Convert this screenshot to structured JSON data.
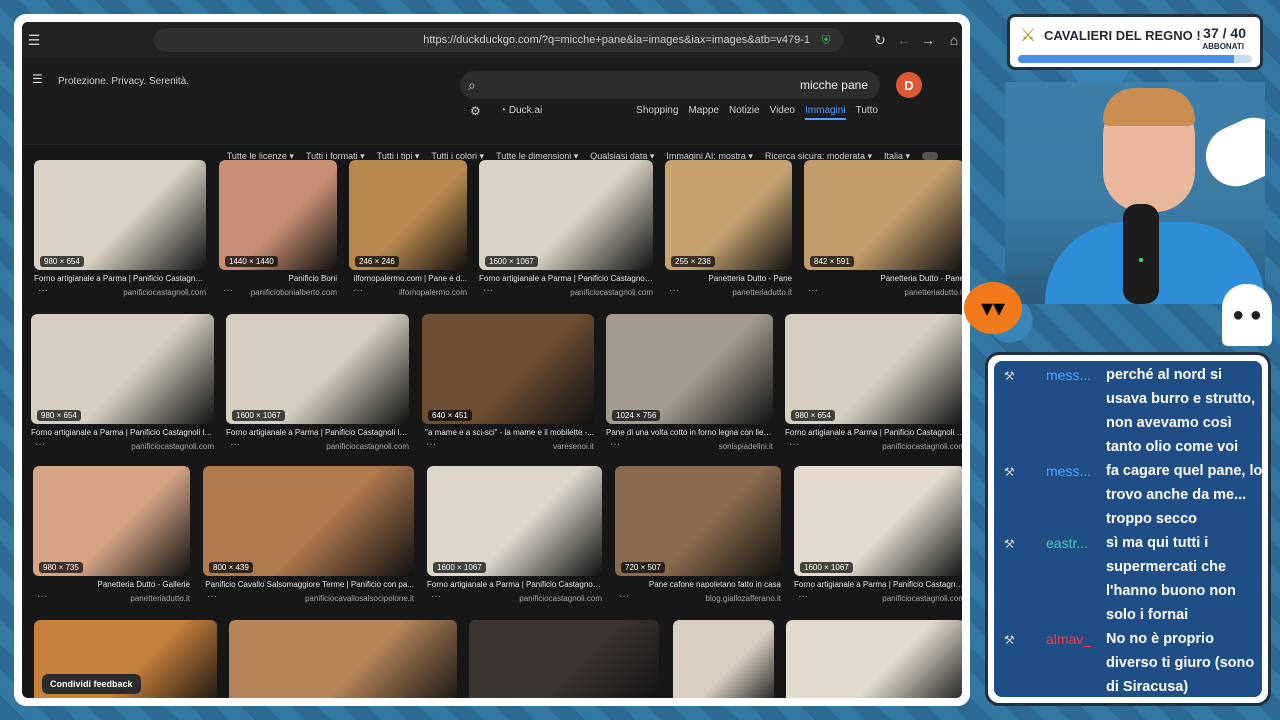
{
  "browser": {
    "url": "https://duckduckgo.com/?q=micche+pane&ia=images&iax=images&atb=v479-1",
    "tagline": "Protezione. Privacy. Serenità.",
    "search_query": "micche pane",
    "tabs": [
      "Tutto",
      "Immagini",
      "Video",
      "Notizie",
      "Mappe",
      "Shopping"
    ],
    "active_tab": "Immagini",
    "duck_ai": "Duck.ai",
    "filters": [
      "Italia",
      "Ricerca sicura: moderata",
      "Immagini AI: mostra",
      "Qualsiasi data",
      "Tutte le dimensioni",
      "Tutti i colori",
      "Tutti i tipi",
      "Tutti i formati",
      "Tutte le licenze"
    ],
    "feedback_label": "Condividi feedback"
  },
  "images": [
    {
      "title": "Forno artigianale a Parma | Panificio Castagnol...",
      "source": "panificiocastagnoli.com",
      "dim": "980 × 654",
      "color": "#d9d2c4"
    },
    {
      "title": "Panificio Boni",
      "source": "panificiobonialberto.com",
      "dim": "1440 × 1440",
      "color": "#c88f74"
    },
    {
      "title": "ilfornopalermo.com | Pane e d...",
      "source": "ilfornopalermo.com",
      "dim": "246 × 246",
      "color": "#b8894e"
    },
    {
      "title": "Forno artigianale a Parma | Panificio Castagnol...",
      "source": "panificiocastagnoli.com",
      "dim": "1600 × 1067",
      "color": "#d9d2c4"
    },
    {
      "title": "Panetteria Dutto - Pane",
      "source": "panetteriadutto.it",
      "dim": "255 × 236",
      "color": "#c6a271"
    },
    {
      "title": "Panetteria Dutto - Pane",
      "source": "panetteriadutto.it",
      "dim": "842 × 591",
      "color": "#c39c6b"
    },
    {
      "title": "Forno artigianale a Parma | Panificio Castagnoli la...",
      "source": "panificiocastagnoli.com",
      "dim": "980 × 654",
      "color": "#d6cfc1"
    },
    {
      "title": "Forno artigianale a Parma | Panificio Castagnoli la...",
      "source": "panificiocastagnoli.com",
      "dim": "1600 × 1067",
      "color": "#d6cfc1"
    },
    {
      "title": "\"a mame e a sci-sci\" - la mame e il mobilette -...",
      "source": "varesenoi.it",
      "dim": "640 × 451",
      "color": "#6e4f33"
    },
    {
      "title": "Pane di una volta cotto in forno legna con lievito...",
      "source": "sonispiadelini.it",
      "dim": "1024 × 756",
      "color": "#a39b8f"
    },
    {
      "title": "Forno artigianale a Parma | Panificio Castagnoli la...",
      "source": "panificiocastagnoli.com",
      "dim": "980 × 654",
      "color": "#d6cfc1"
    },
    {
      "title": "Panetteria Dutto - Gallerie",
      "source": "panetteriadutto.it",
      "dim": "980 × 735",
      "color": "#d6a586"
    },
    {
      "title": "Panificio Cavallo Salsomaggiore Terme | Panificio con pa...",
      "source": "panificiocavallosalsocipolone.it",
      "dim": "800 × 439",
      "color": "#b07a4f"
    },
    {
      "title": "Forno artigianale a Parma | Panificio Castagnoli...",
      "source": "panificiocastagnoli.com",
      "dim": "1600 × 1067",
      "color": "#dcd6cb"
    },
    {
      "title": "Pane cafone napoletano fatto in casa",
      "source": "blog.giallozafferano.it",
      "dim": "720 × 507",
      "color": "#8a6b4d"
    },
    {
      "title": "Forno artigianale a Parma | Panificio Castagnoli...",
      "source": "panificiocastagnoli.com",
      "dim": "1600 × 1067",
      "color": "#e3dccf"
    },
    {
      "color": "#c8813c"
    },
    {
      "color": "#b58559"
    },
    {
      "color": "#3c3430"
    },
    {
      "color": "#d8cfc1"
    },
    {
      "color": "#e2dbce"
    }
  ],
  "goal": {
    "title": "CAVALIERI DEL REGNO !",
    "count": "37 / 40",
    "count_label": "ABBONATI",
    "progress": 0.925
  },
  "chat": [
    {
      "user": "mess...",
      "user_color": "#4da3ff",
      "text": "perché al nord si usava burro e strutto, non avevamo così tanto olio come voi"
    },
    {
      "user": "mess...",
      "user_color": "#4da3ff",
      "text": "fa cagare quel pane, lo trovo anche da me... troppo secco"
    },
    {
      "user": "eastr...",
      "user_color": "#46c9b8",
      "text": "sì ma qui tutti i supermercati che l'hanno buono non solo i fornai"
    },
    {
      "user": "almav_",
      "user_color": "#ff3a3a",
      "text": "No no è proprio diverso ti giuro (sono di Siracusa)"
    }
  ]
}
